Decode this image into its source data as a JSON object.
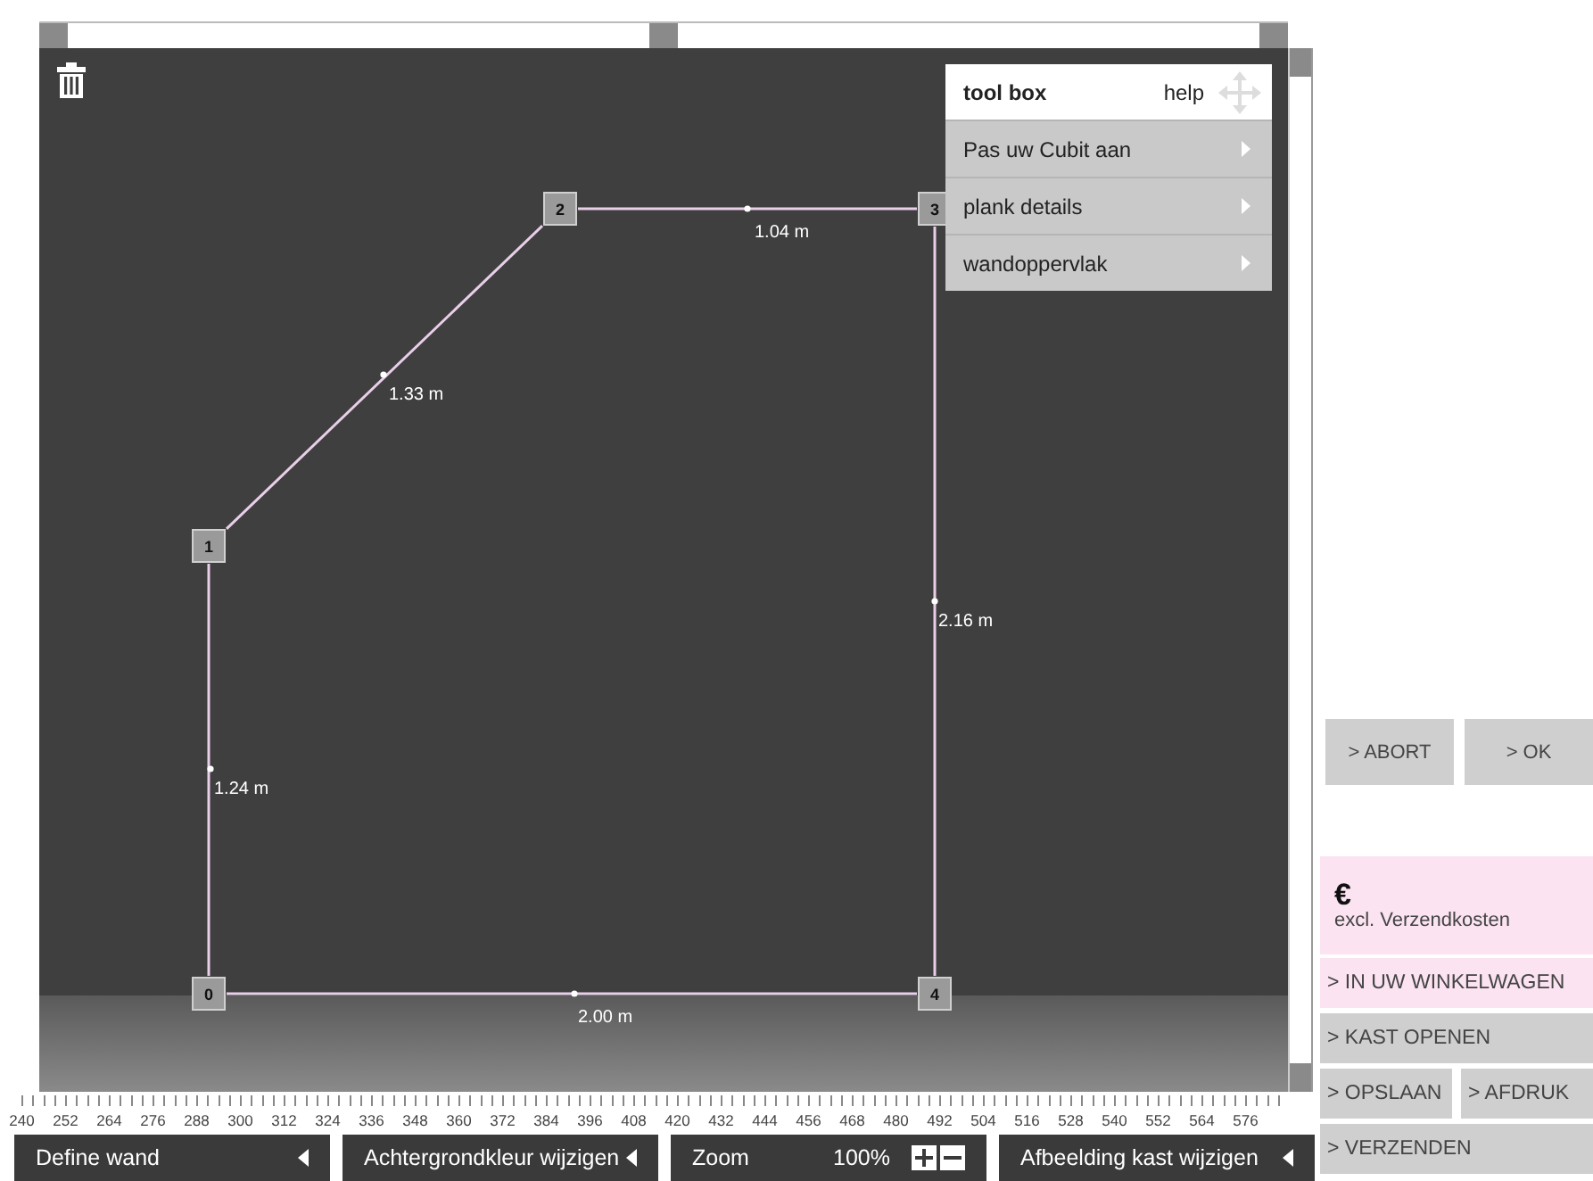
{
  "toolbox": {
    "title": "tool box",
    "help": "help",
    "items": [
      {
        "label": "Pas uw Cubit aan"
      },
      {
        "label": "plank details"
      },
      {
        "label": "wandoppervlak"
      }
    ]
  },
  "plan": {
    "nodes": [
      {
        "label": "0"
      },
      {
        "label": "1"
      },
      {
        "label": "2"
      },
      {
        "label": "3"
      },
      {
        "label": "4"
      }
    ],
    "walls": [
      {
        "length": "1.24 m"
      },
      {
        "length": "1.33 m"
      },
      {
        "length": "1.04 m"
      },
      {
        "length": "2.16 m"
      },
      {
        "length": "2.00 m"
      }
    ]
  },
  "ruler": [
    "240",
    "252",
    "264",
    "276",
    "288",
    "300",
    "312",
    "324",
    "336",
    "348",
    "360",
    "372",
    "384",
    "396",
    "408",
    "420",
    "432",
    "444",
    "456",
    "468",
    "480",
    "492",
    "504",
    "516",
    "528",
    "540",
    "552",
    "564",
    "576"
  ],
  "bottom_bar": [
    {
      "kind": "menu",
      "label": "Define wand"
    },
    {
      "kind": "menu",
      "label": "Achtergrondkleur wijzigen"
    },
    {
      "kind": "zoom",
      "label": "Zoom",
      "value": "100%"
    },
    {
      "kind": "menu",
      "label": "Afbeelding kast wijzigen"
    }
  ],
  "side_panel": {
    "confirm_buttons": [
      "> ABORT",
      "> OK"
    ],
    "price": {
      "currency": "€",
      "note": "excl. Verzendkosten"
    },
    "actions": [
      {
        "kind": "cart",
        "labels": [
          "> IN UW WINKELWAGEN"
        ]
      },
      {
        "kind": "plain",
        "labels": [
          "> KAST OPENEN"
        ]
      },
      {
        "kind": "plain",
        "labels": [
          "> OPSLAAN",
          "> AFDRUK"
        ]
      },
      {
        "kind": "plain",
        "labels": [
          "> VERZENDEN"
        ]
      }
    ]
  }
}
